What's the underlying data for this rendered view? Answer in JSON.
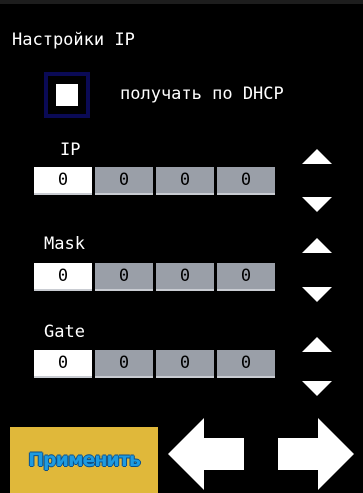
{
  "window": {
    "title": "Настройки IP"
  },
  "dhcp": {
    "label": "получать по DHCP",
    "checked": false
  },
  "fields": [
    {
      "label": "IP",
      "octets": [
        "0",
        "0",
        "0",
        "0"
      ]
    },
    {
      "label": "Mask",
      "octets": [
        "0",
        "0",
        "0",
        "0"
      ]
    },
    {
      "label": "Gate",
      "octets": [
        "0",
        "0",
        "0",
        "0"
      ]
    }
  ],
  "buttons": {
    "apply": "Применить"
  },
  "icons": {
    "increment": "triangle-up-icon",
    "decrement": "triangle-down-icon",
    "back": "arrow-left-icon",
    "forward": "arrow-right-icon"
  },
  "colors": {
    "background": "#000000",
    "octet_active": "#ffffff",
    "octet_inactive": "#9a9fa8",
    "apply_button": "#e0b83a",
    "apply_text": "#1e9be0",
    "checkbox_border": "#0a0a55"
  }
}
